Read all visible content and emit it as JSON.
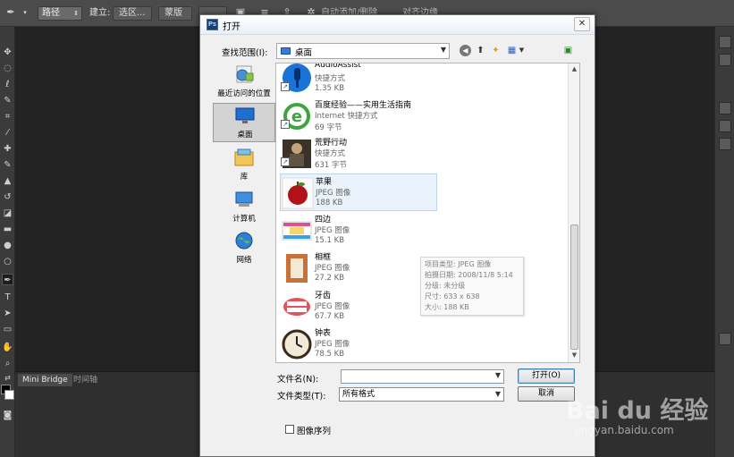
{
  "ps": {
    "options": {
      "path_select": "路径",
      "make_label": "建立:",
      "selection_btn": "选区...",
      "mask_btn": "蒙版",
      "auto_add_delete": "自动添加/删除",
      "align_edges": "对齐边缘"
    },
    "bottom_tabs": [
      "Mini Bridge",
      "时间轴"
    ]
  },
  "dialog": {
    "title": "打开",
    "close_label": "✕",
    "look_in_label": "查找范围(I):",
    "look_in_value": "桌面",
    "places": [
      {
        "label": "最近访问的位置"
      },
      {
        "label": "桌面"
      },
      {
        "label": "库"
      },
      {
        "label": "计算机"
      },
      {
        "label": "网络"
      }
    ],
    "files": [
      {
        "name": "AudioAssist",
        "type": "快捷方式",
        "size": "1.35 KB"
      },
      {
        "name": "百度经验——实用生活指南",
        "type": "Internet 快捷方式",
        "size": "69 字节"
      },
      {
        "name": "荒野行动",
        "type": "快捷方式",
        "size": "631 字节"
      },
      {
        "name": "苹果",
        "type": "JPEG 图像",
        "size": "188 KB"
      },
      {
        "name": "四边",
        "type": "JPEG 图像",
        "size": "15.1 KB"
      },
      {
        "name": "相框",
        "type": "JPEG 图像",
        "size": "27.2 KB"
      },
      {
        "name": "牙齿",
        "type": "JPEG 图像",
        "size": "67.7 KB"
      },
      {
        "name": "钟表",
        "type": "JPEG 图像",
        "size": "78.5 KB"
      }
    ],
    "tooltip": {
      "line1": "项目类型: JPEG 图像",
      "line2": "拍摄日期: 2008/11/8 5:14",
      "line3": "分级: 未分级",
      "line4": "尺寸: 633 x 638",
      "line5": "大小: 188 KB"
    },
    "file_name_label": "文件名(N):",
    "file_name_value": "",
    "file_type_label": "文件类型(T):",
    "file_type_value": "所有格式",
    "open_button": "打开(O)",
    "cancel_button": "取消",
    "image_sequence_label": "图像序列"
  },
  "watermark": {
    "brand": "Bai du 经验",
    "url": "jingyan.baidu.com"
  }
}
